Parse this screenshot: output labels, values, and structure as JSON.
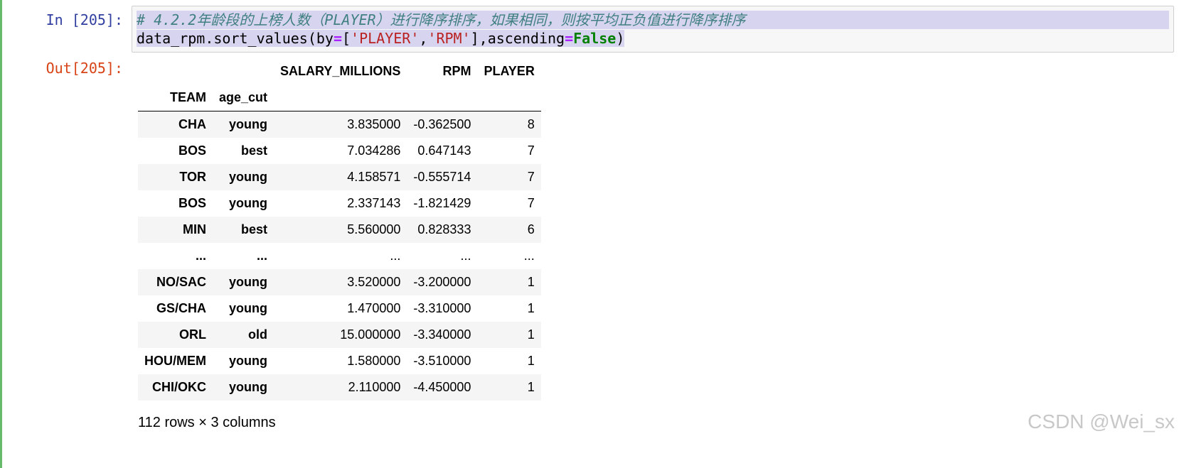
{
  "cell": {
    "in_prompt": "In [205]:",
    "out_prompt": "Out[205]:",
    "code": {
      "comment": "# 4.2.2年龄段的上榜人数（PLAYER）进行降序排序，如果相同，则按平均正负值进行降序排序",
      "line2": {
        "p1": "data_rpm.sort_values(by",
        "eq1": "=",
        "p2": "[",
        "s1": "'PLAYER'",
        "comma": ",",
        "s2": "'RPM'",
        "p3": "],ascending",
        "eq2": "=",
        "kw": "False",
        "p4": ")"
      }
    }
  },
  "table": {
    "columns": [
      "SALARY_MILLIONS",
      "RPM",
      "PLAYER"
    ],
    "index_names": [
      "TEAM",
      "age_cut"
    ],
    "rows": [
      {
        "team": "CHA",
        "age_cut": "young",
        "salary": "3.835000",
        "rpm": "-0.362500",
        "player": "8"
      },
      {
        "team": "BOS",
        "age_cut": "best",
        "salary": "7.034286",
        "rpm": "0.647143",
        "player": "7"
      },
      {
        "team": "TOR",
        "age_cut": "young",
        "salary": "4.158571",
        "rpm": "-0.555714",
        "player": "7"
      },
      {
        "team": "BOS",
        "age_cut": "young",
        "salary": "2.337143",
        "rpm": "-1.821429",
        "player": "7"
      },
      {
        "team": "MIN",
        "age_cut": "best",
        "salary": "5.560000",
        "rpm": "0.828333",
        "player": "6"
      },
      {
        "team": "...",
        "age_cut": "...",
        "salary": "...",
        "rpm": "...",
        "player": "..."
      },
      {
        "team": "NO/SAC",
        "age_cut": "young",
        "salary": "3.520000",
        "rpm": "-3.200000",
        "player": "1"
      },
      {
        "team": "GS/CHA",
        "age_cut": "young",
        "salary": "1.470000",
        "rpm": "-3.310000",
        "player": "1"
      },
      {
        "team": "ORL",
        "age_cut": "old",
        "salary": "15.000000",
        "rpm": "-3.340000",
        "player": "1"
      },
      {
        "team": "HOU/MEM",
        "age_cut": "young",
        "salary": "1.580000",
        "rpm": "-3.510000",
        "player": "1"
      },
      {
        "team": "CHI/OKC",
        "age_cut": "young",
        "salary": "2.110000",
        "rpm": "-4.450000",
        "player": "1"
      }
    ],
    "shape_note": "112 rows × 3 columns"
  },
  "watermark": "CSDN @Wei_sx",
  "colors": {
    "in_prompt": "#303f9f",
    "out_prompt": "#d84315",
    "cell_border": "#66bb6a",
    "comment": "#408080",
    "selection": "#d7d4f0"
  }
}
